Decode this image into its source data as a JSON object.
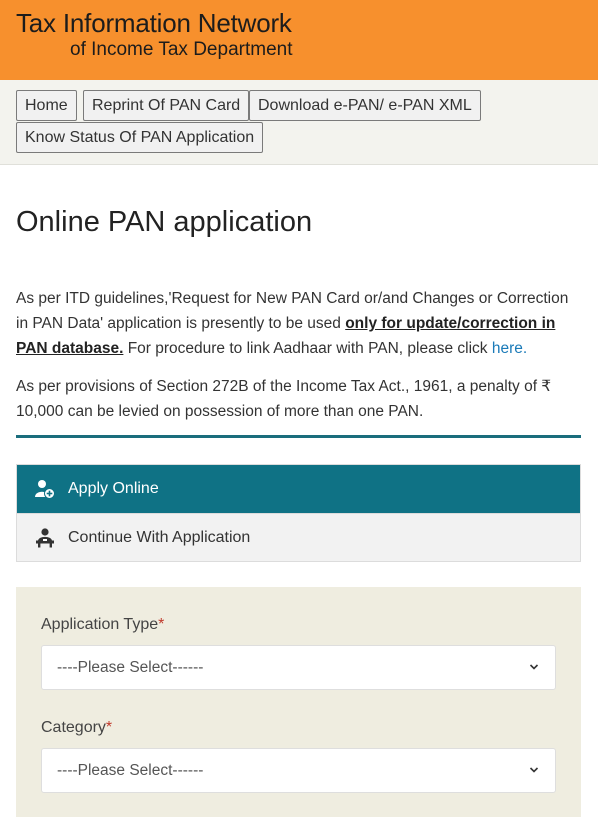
{
  "header": {
    "title_line1": "Tax Information Network",
    "title_line2": "of Income Tax Department",
    "bg_color": "#f7902d"
  },
  "nav": {
    "items": [
      {
        "label": "Home"
      },
      {
        "label": "Reprint Of PAN Card"
      },
      {
        "label": "Download e-PAN/ e-PAN XML"
      },
      {
        "label": "Know Status Of PAN Application"
      }
    ]
  },
  "page": {
    "title": "Online PAN application",
    "para1_before": "As per ITD guidelines,'Request for New PAN Card or/and Changes or Correction in PAN Data' application is presently to be used ",
    "para1_bold": "only for update/correction in PAN database.",
    "para1_after": " For procedure to link Aadhaar with PAN, please click ",
    "para1_link": "here.",
    "para2": "As per provisions of Section 272B of the Income Tax Act., 1961, a penalty of ₹ 10,000 can be levied on possession of more than one PAN."
  },
  "menu": {
    "items": [
      {
        "label": "Apply Online",
        "icon": "add-user-icon",
        "active": true
      },
      {
        "label": "Continue With Application",
        "icon": "user-desk-icon",
        "active": false
      }
    ],
    "accent_color": "#0f7285"
  },
  "form": {
    "application_type_label": "Application Type",
    "application_type_value": "----Please Select------",
    "category_label": "Category",
    "category_value": "----Please Select------",
    "required_mark": "*",
    "panel_color": "#efede0"
  }
}
